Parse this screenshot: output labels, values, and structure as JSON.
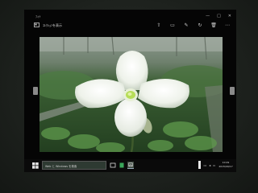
{
  "app": {
    "name": "ﾌｫﾄ",
    "file_name": "ｺﾚｸｼｮﾝを表示"
  },
  "window_controls": {
    "minimize": "—",
    "maximize": "□",
    "close": "✕"
  },
  "toolbar": {
    "icons": [
      "share-icon",
      "slideshow-icon",
      "edit-icon",
      "rotate-icon",
      "delete-icon",
      "more-icon"
    ],
    "glyphs": [
      "⇧",
      "▭",
      "✎",
      "↻",
      "🗑",
      "⋯"
    ]
  },
  "photo": {
    "subject": "white lady slipper orchid",
    "colors": {
      "petal": "#f2f4ef",
      "center": "#b9e060",
      "background_leaf": "#3d6b34",
      "greenhouse": "#7f8a80"
    }
  },
  "taskbar": {
    "search_placeholder": "Web と Windows を検索",
    "clock_time": "10:29",
    "clock_date": "2015/09/17"
  }
}
